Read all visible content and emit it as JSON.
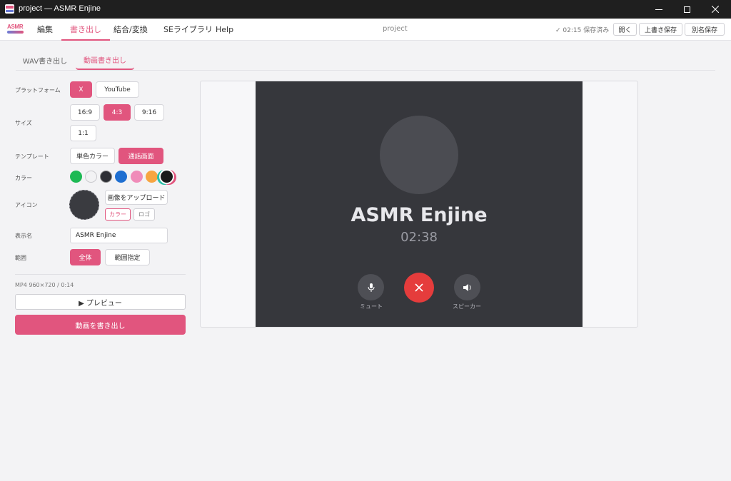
{
  "window": {
    "title": "project — ASMR Enjine"
  },
  "logo": {
    "line1": "ASMR",
    "line2": ""
  },
  "menu": {
    "items": [
      "編集",
      "書き出し",
      "結合/変換",
      "SEライブラリ",
      "Help"
    ],
    "active_index": 1
  },
  "header": {
    "project_name": "project",
    "save_status": "✓ 02:15 保存済み",
    "buttons": [
      "開く",
      "上書き保存",
      "別名保存"
    ]
  },
  "subtabs": {
    "items": [
      "WAV書き出し",
      "動画書き出し"
    ],
    "active_index": 1
  },
  "form": {
    "platform": {
      "label": "プラットフォーム",
      "options": [
        "X",
        "YouTube"
      ],
      "selected": "X"
    },
    "size": {
      "label": "サイズ",
      "options": [
        "16:9",
        "4:3",
        "9:16",
        "1:1"
      ],
      "selected": "4:3"
    },
    "template": {
      "label": "テンプレート",
      "options": [
        "単色カラー",
        "通話画面"
      ],
      "selected": "通話画面"
    },
    "color": {
      "label": "カラー",
      "swatches": [
        "#1db954",
        "#f2f2f4",
        "#2e2f35",
        "#1f6fd1",
        "#f08cb9",
        "#f7a541",
        "#1a1a1a"
      ],
      "selected_index": 6
    },
    "icon": {
      "label": "アイコン",
      "upload_label": "画像をアップロード",
      "modes": [
        "カラー",
        "ロゴ"
      ],
      "selected_mode": "カラー"
    },
    "display_name": {
      "label": "表示名",
      "value": "ASMR Enjine"
    },
    "range": {
      "label": "範囲",
      "options": [
        "全体",
        "範囲指定"
      ],
      "selected": "全体"
    },
    "meta": "MP4 960×720 / 0:14",
    "preview_label": "▶ プレビュー",
    "export_label": "動画を書き出し"
  },
  "preview": {
    "caller_name": "ASMR Enjine",
    "elapsed": "02:38",
    "mute_label": "ミュート",
    "speaker_label": "スピーカー",
    "colors": {
      "background": "#36373c",
      "hangup": "#e53c3c",
      "accent": "#e1557e"
    }
  }
}
